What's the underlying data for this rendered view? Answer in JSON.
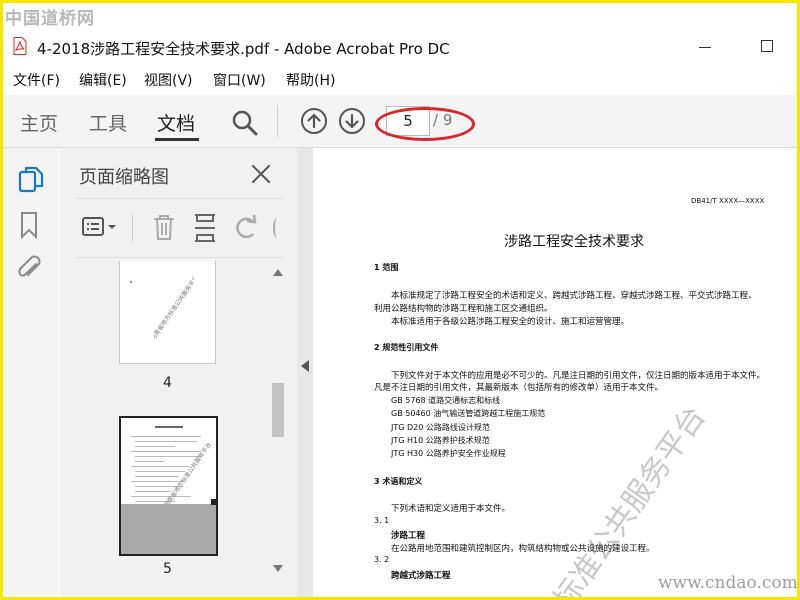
{
  "watermark": {
    "site_cn": "中国道桥网",
    "site_url": "www.cndao.com",
    "doc_watermark": "标准公共服务平台"
  },
  "window": {
    "title": "4-2018涉路工程安全技术要求.pdf - Adobe Acrobat Pro DC"
  },
  "menu": [
    "文件(F)",
    "编辑(E)",
    "视图(V)",
    "窗口(W)",
    "帮助(H)"
  ],
  "toolbar": {
    "tabs": [
      "主页",
      "工具",
      "文档"
    ],
    "active_tab": "文档",
    "current_page": "5",
    "total_pages": "/ 9"
  },
  "thumbnails": {
    "title": "页面缩略图",
    "pages": [
      {
        "label": "4",
        "watermark": "河南省地方标准公共服务平台"
      },
      {
        "label": "5",
        "watermark": "河南省地方标准公共服务平台"
      }
    ]
  },
  "document": {
    "code": "DB41/T XXXX—XXXX",
    "title": "涉路工程安全技术要求",
    "s1_heading": "1   范围",
    "s1_p1a": "本标准规定了涉路工程安全的术语和定义、跨越式涉路工程、穿越式涉路工程、平交式涉路工程、",
    "s1_p1b": "利用公路结构物的涉路工程和施工区交通组织。",
    "s1_p2": "本标准适用于各级公路涉路工程安全的设计、施工和运营管理。",
    "s2_heading": "2   规范性引用文件",
    "s2_p1a": "下列文件对于本文件的应用是必不可少的。凡是注日期的引用文件，仅注日期的版本适用于本文件。",
    "s2_p1b": "凡是不注日期的引用文件，其最新版本（包括所有的修改单）适用于本文件。",
    "refs": [
      "GB  5768   道路交通标志和标线",
      "GB  50460   油气输送管道跨越工程施工规范",
      "JTG  D20    公路路线设计规范",
      "JTG  H10    公路养护技术规范",
      "JTG  H30    公路养护安全作业规程"
    ],
    "s3_heading": "3   术语和定义",
    "s3_p1": "下列术语和定义适用于本文件。",
    "s31_num": "3. 1",
    "s31_term": "涉路工程",
    "s31_def": "在公路用地范围和建筑控制区内，构筑结构物或公共设施的建设工程。",
    "s32_num": "3. 2",
    "s32_term": "跨越式涉路工程"
  },
  "colors": {
    "annotation_ring": "#d8262a",
    "frame_border": "#f6e600",
    "pdf_icon": "#d42b26"
  }
}
